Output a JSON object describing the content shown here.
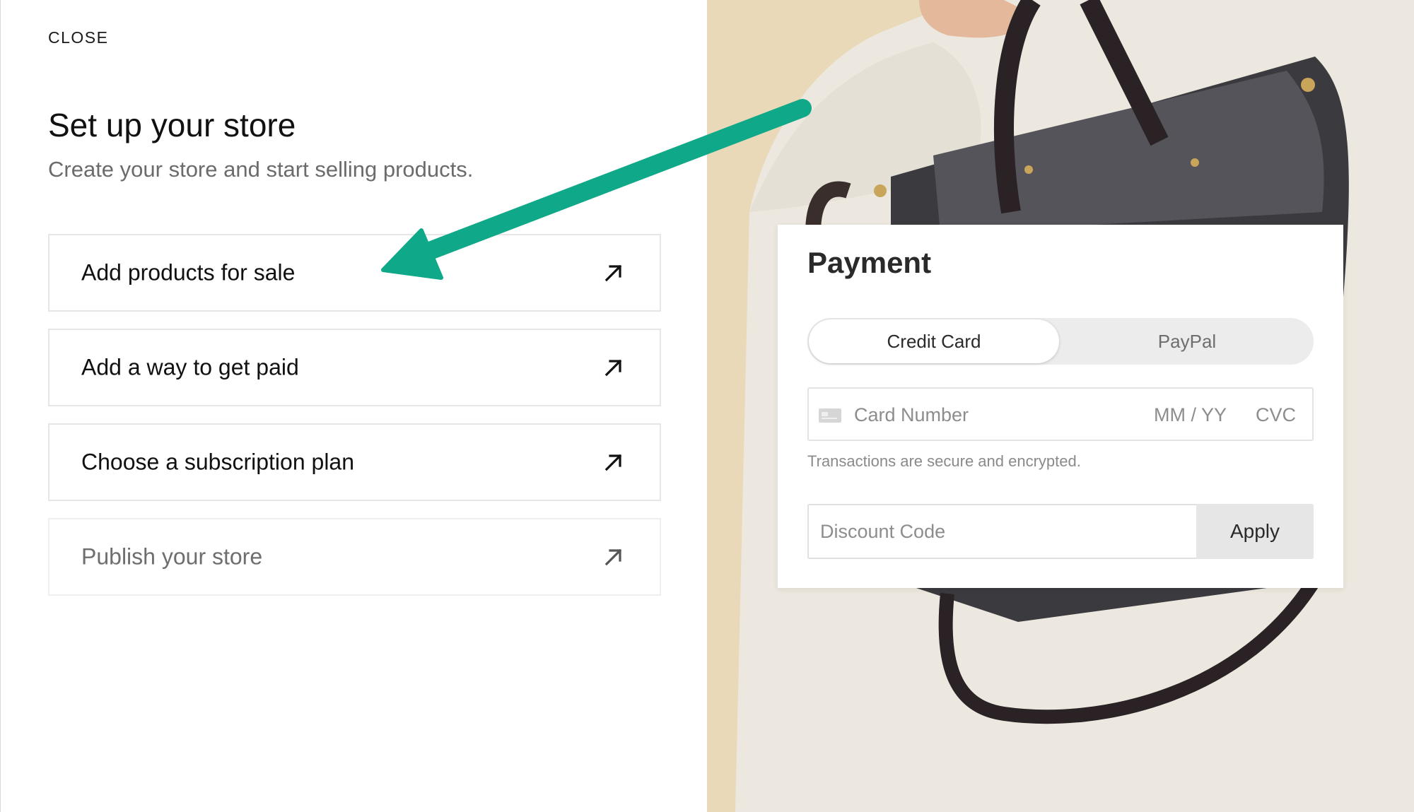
{
  "left": {
    "close_label": "CLOSE",
    "title": "Set up your store",
    "subtitle": "Create your store and start selling products.",
    "steps": [
      {
        "label": "Add products for sale",
        "icon": "arrow-up-right-icon"
      },
      {
        "label": "Add a way to get paid",
        "icon": "arrow-up-right-icon"
      },
      {
        "label": "Choose a subscription plan",
        "icon": "arrow-up-right-icon"
      },
      {
        "label": "Publish your store",
        "icon": "arrow-up-right-icon",
        "muted": true
      }
    ]
  },
  "payment": {
    "title": "Payment",
    "tabs": {
      "credit_card": "Credit Card",
      "paypal": "PayPal",
      "selected": "Credit Card"
    },
    "card_number_placeholder": "Card Number",
    "expiry_placeholder": "MM / YY",
    "cvc_placeholder": "CVC",
    "secure_note": "Transactions are secure and encrypted.",
    "discount_placeholder": "Discount Code",
    "apply_label": "Apply"
  },
  "colors": {
    "annotation_arrow": "#0fa888",
    "background_photo": "#e8d8b8"
  }
}
